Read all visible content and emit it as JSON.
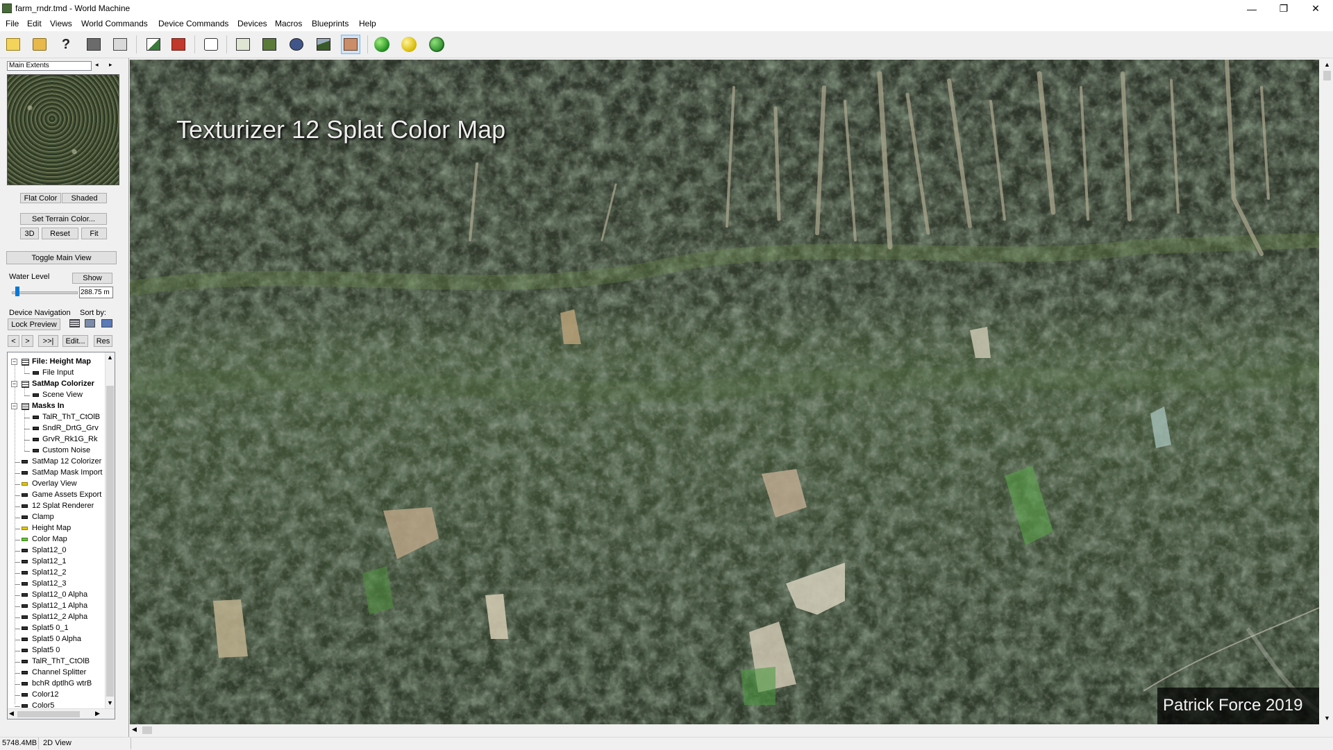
{
  "window": {
    "title": "farm_rndr.tmd - World Machine"
  },
  "menu": [
    "File",
    "Edit",
    "Views",
    "World Commands",
    "Device Commands",
    "Devices",
    "Macros",
    "Blueprints",
    "Help"
  ],
  "left": {
    "extents_select": "Main Extents",
    "flat_color": "Flat Color",
    "shaded": "Shaded",
    "set_terrain_color": "Set Terrain Color...",
    "btn_3d": "3D",
    "btn_reset": "Reset",
    "btn_fit": "Fit",
    "toggle_main_view": "Toggle Main View",
    "water_level_label": "Water Level",
    "show_btn": "Show",
    "water_value": "288.75 m",
    "water_level_fraction": 0.05,
    "device_nav_label": "Device Navigation",
    "sort_by_label": "Sort by:",
    "lock_preview": "Lock Preview",
    "nav_prev": "<",
    "nav_next": ">",
    "nav_last": ">>|",
    "edit_btn": "Edit...",
    "res_btn": "Res"
  },
  "tree": [
    {
      "label": "File: Height Map",
      "level": 0,
      "bold": true,
      "type": "group"
    },
    {
      "label": "File Input",
      "level": 1,
      "type": "device"
    },
    {
      "label": "SatMap Colorizer",
      "level": 0,
      "bold": true,
      "type": "group"
    },
    {
      "label": "Scene View",
      "level": 1,
      "type": "device"
    },
    {
      "label": "Masks In",
      "level": 0,
      "bold": true,
      "type": "group"
    },
    {
      "label": "TalR_ThT_CtOlB",
      "level": 1,
      "type": "device"
    },
    {
      "label": "SndR_DrtG_Grv",
      "level": 1,
      "type": "device"
    },
    {
      "label": "GrvR_Rk1G_Rk",
      "level": 1,
      "type": "device"
    },
    {
      "label": "Custom Noise",
      "level": 1,
      "type": "device"
    },
    {
      "label": "SatMap 12 Colorizer",
      "level": 0,
      "type": "device"
    },
    {
      "label": "SatMap Mask Import",
      "level": 0,
      "type": "device"
    },
    {
      "label": "Overlay View",
      "level": 0,
      "type": "device",
      "color": "yellow"
    },
    {
      "label": "Game Assets Export",
      "level": 0,
      "type": "device"
    },
    {
      "label": "12 Splat Renderer",
      "level": 0,
      "type": "device"
    },
    {
      "label": "Clamp",
      "level": 0,
      "type": "device"
    },
    {
      "label": "Height Map",
      "level": 0,
      "type": "device",
      "color": "yellow"
    },
    {
      "label": "Color Map",
      "level": 0,
      "type": "device",
      "color": "green"
    },
    {
      "label": "Splat12_0",
      "level": 0,
      "type": "device"
    },
    {
      "label": "Splat12_1",
      "level": 0,
      "type": "device"
    },
    {
      "label": "Splat12_2",
      "level": 0,
      "type": "device"
    },
    {
      "label": "Splat12_3",
      "level": 0,
      "type": "device"
    },
    {
      "label": "Splat12_0 Alpha",
      "level": 0,
      "type": "device"
    },
    {
      "label": "Splat12_1 Alpha",
      "level": 0,
      "type": "device"
    },
    {
      "label": "Splat12_2 Alpha",
      "level": 0,
      "type": "device"
    },
    {
      "label": "Splat5 0_1",
      "level": 0,
      "type": "device"
    },
    {
      "label": "Splat5 0 Alpha",
      "level": 0,
      "type": "device"
    },
    {
      "label": "Splat5 0",
      "level": 0,
      "type": "device"
    },
    {
      "label": "TalR_ThT_CtOlB",
      "level": 0,
      "type": "device"
    },
    {
      "label": "Channel Splitter",
      "level": 0,
      "type": "device"
    },
    {
      "label": "bchR dptlhG wtrB",
      "level": 0,
      "type": "device"
    },
    {
      "label": "Color12",
      "level": 0,
      "type": "device"
    },
    {
      "label": "Color5",
      "level": 0,
      "type": "device"
    }
  ],
  "viewport": {
    "overlay_title": "Texturizer 12 Splat  Color Map",
    "watermark": "Patrick Force 2019"
  },
  "status": {
    "memory": "5748.4MB",
    "view": "2D View"
  },
  "toolbar_icons": [
    "new-icon",
    "open-icon",
    "help-icon",
    "save-icon",
    "export-icon",
    "build-icon",
    "stop-icon",
    "dice-icon",
    "device-view-icon",
    "layout-view-icon",
    "explorer-view-icon",
    "3d-view-icon",
    "2d-view-icon",
    "green-ball-icon",
    "yellow-ball-icon",
    "globe-icon"
  ]
}
